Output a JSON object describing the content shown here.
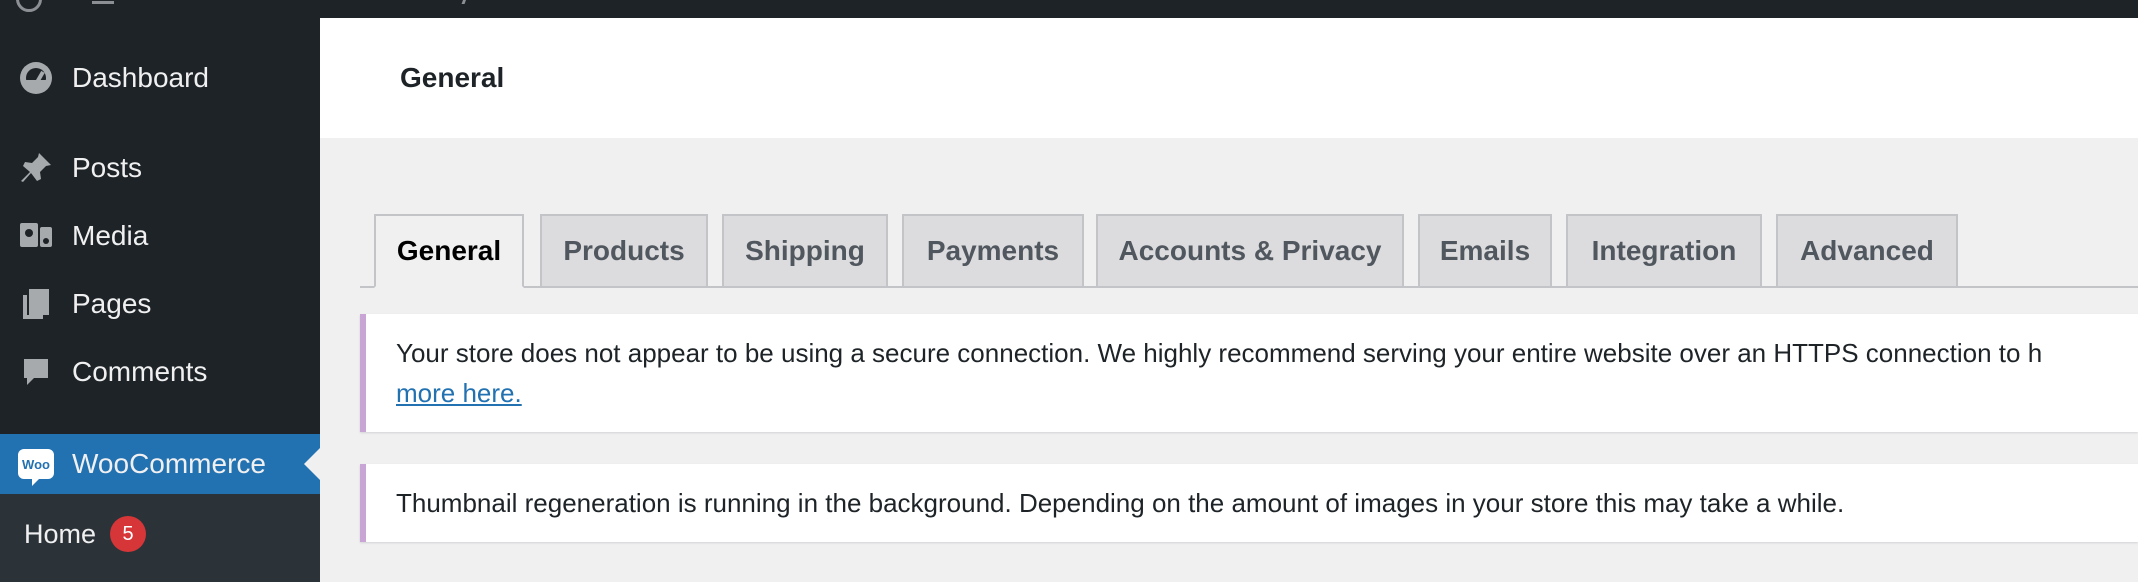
{
  "sidebar": {
    "items": [
      {
        "label": "Dashboard",
        "icon": "dashboard-icon"
      },
      {
        "label": "Posts",
        "icon": "pushpin-icon"
      },
      {
        "label": "Media",
        "icon": "media-icon"
      },
      {
        "label": "Pages",
        "icon": "pages-icon"
      },
      {
        "label": "Comments",
        "icon": "comment-icon"
      },
      {
        "label": "WooCommerce",
        "icon": "woocommerce-icon",
        "woo_text": "Woo"
      }
    ],
    "submenu": {
      "label": "Home",
      "badge": "5"
    }
  },
  "header": {
    "title": "General"
  },
  "tabs": [
    {
      "label": "General",
      "active": true
    },
    {
      "label": "Products"
    },
    {
      "label": "Shipping"
    },
    {
      "label": "Payments"
    },
    {
      "label": "Accounts & Privacy"
    },
    {
      "label": "Emails"
    },
    {
      "label": "Integration"
    },
    {
      "label": "Advanced"
    }
  ],
  "notices": {
    "https": {
      "text": "Your store does not appear to be using a secure connection. We highly recommend serving your entire website over an HTTPS connection to h",
      "link": "more here."
    },
    "thumbnail": {
      "text": "Thumbnail regeneration is running in the background. Depending on the amount of images in your store this may take a while."
    }
  },
  "colors": {
    "sidebar_bg": "#1d2327",
    "active_menu": "#2271b1",
    "badge": "#d63638",
    "notice_border": "#c9a5d6",
    "link": "#2271b1"
  }
}
